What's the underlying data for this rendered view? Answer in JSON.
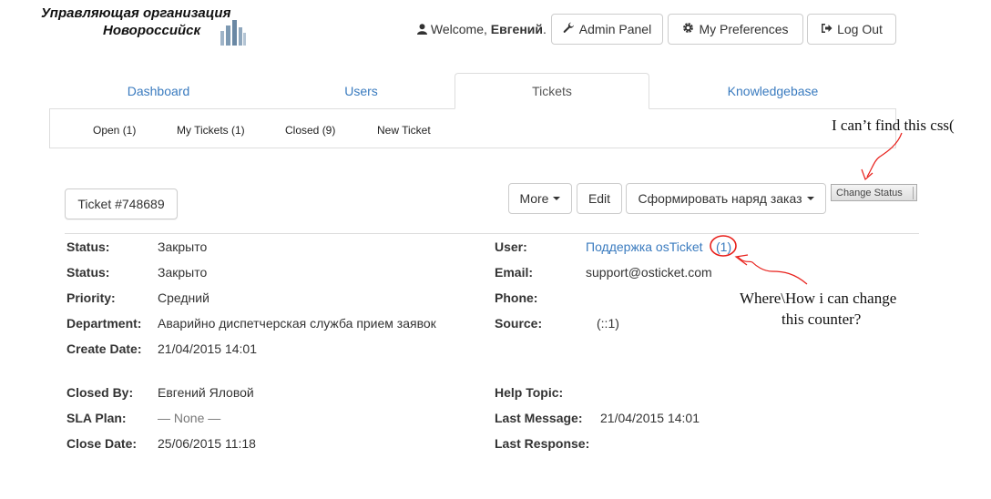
{
  "logo": {
    "line1": "Управляющая организация",
    "line2": "Новороссийск"
  },
  "header": {
    "welcome_prefix": "Welcome,",
    "user_name": "Евгений",
    "welcome_suffix": ".",
    "admin_panel": "Admin Panel",
    "my_preferences": "My Preferences",
    "log_out": "Log Out"
  },
  "tabs": [
    {
      "label": "Dashboard",
      "active": false
    },
    {
      "label": "Users",
      "active": false
    },
    {
      "label": "Tickets",
      "active": true
    },
    {
      "label": "Knowledgebase",
      "active": false
    }
  ],
  "subnav": [
    {
      "label": "Open (1)"
    },
    {
      "label": "My Tickets (1)"
    },
    {
      "label": "Closed (9)"
    },
    {
      "label": "New Ticket"
    }
  ],
  "ticket": {
    "number_label": "Ticket #748689",
    "more_button": "More",
    "edit_button": "Edit",
    "form_button": "Сформировать наряд заказ",
    "change_status_button": "Change Status"
  },
  "info_left": [
    {
      "label": "Status:",
      "value": "Закрыто"
    },
    {
      "label": "Status:",
      "value": "Закрыто"
    },
    {
      "label": "Priority:",
      "value": "Средний"
    },
    {
      "label": "Department:",
      "value": "Аварийно диспетчерская служба прием заявок"
    },
    {
      "label": "Create Date:",
      "value": "21/04/2015 14:01"
    }
  ],
  "info_right": {
    "user_label": "User:",
    "user_value": "Поддержка osTicket",
    "user_count": "(1)",
    "email_label": "Email:",
    "email_value": "support@osticket.com",
    "phone_label": "Phone:",
    "phone_value": "",
    "source_label": "Source:",
    "source_value": "(::1)"
  },
  "info_bottom_left": [
    {
      "label": "Closed By:",
      "value": "Евгений Яловой"
    },
    {
      "label": "SLA Plan:",
      "value": "— None —"
    },
    {
      "label": "Close Date:",
      "value": "25/06/2015 11:18"
    }
  ],
  "info_bottom_right": [
    {
      "label": "Help Topic:",
      "value": ""
    },
    {
      "label": "Last Message:",
      "value": "21/04/2015 14:01"
    },
    {
      "label": "Last Response:",
      "value": ""
    }
  ],
  "annotations": {
    "css_note": "I can’t find this css(",
    "counter_note_line1": "Where\\How i can change",
    "counter_note_line2": "this counter?",
    "color": "#e8201b"
  }
}
